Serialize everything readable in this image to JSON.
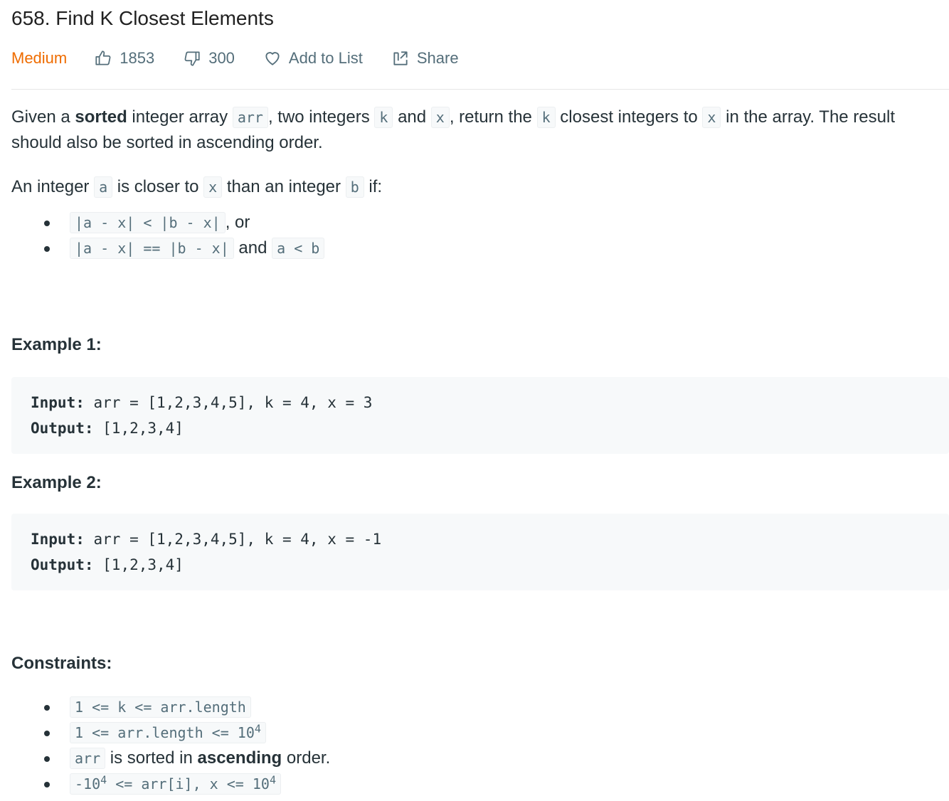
{
  "problem": {
    "title": "658. Find K Closest Elements",
    "difficulty": "Medium",
    "likes": "1853",
    "dislikes": "300",
    "add_to_list": "Add to List",
    "share": "Share"
  },
  "icons": {
    "likes": "thumbs-up-icon",
    "dislikes": "thumbs-down-icon",
    "add_to_list": "heart-icon",
    "share": "share-icon"
  },
  "colors": {
    "difficulty": "#ef6c00",
    "text": "#263238",
    "muted": "#546e7a",
    "code_bg": "#f7f9fa"
  },
  "description": {
    "p1_a": "Given a ",
    "p1_bold": "sorted",
    "p1_b": " integer array ",
    "p1_code1": "arr",
    "p1_c": ", two integers ",
    "p1_code2": "k",
    "p1_d": " and ",
    "p1_code3": "x",
    "p1_e": ", return the ",
    "p1_code4": "k",
    "p1_f": " closest integers to ",
    "p1_code5": "x",
    "p1_g": " in the array. The result should also be sorted in ascending order.",
    "p2_a": "An integer ",
    "p2_code1": "a",
    "p2_b": " is closer to ",
    "p2_code2": "x",
    "p2_c": " than an integer ",
    "p2_code3": "b",
    "p2_d": " if:",
    "bullet1_code": "|a - x| < |b - x|",
    "bullet1_text": ", or",
    "bullet2_code1": "|a - x| == |b - x|",
    "bullet2_text": " and ",
    "bullet2_code2": "a < b"
  },
  "examples": [
    {
      "heading": "Example 1:",
      "input_label": "Input:",
      "input_value": " arr = [1,2,3,4,5], k = 4, x = 3",
      "output_label": "Output:",
      "output_value": " [1,2,3,4]"
    },
    {
      "heading": "Example 2:",
      "input_label": "Input:",
      "input_value": " arr = [1,2,3,4,5], k = 4, x = -1",
      "output_label": "Output:",
      "output_value": " [1,2,3,4]"
    }
  ],
  "constraints": {
    "heading": "Constraints:",
    "c1_code": "1 <= k <= arr.length",
    "c2_code": "1 <= arr.length <= 10",
    "c2_sup": "4",
    "c3_code": "arr",
    "c3_a": " is sorted in ",
    "c3_bold": "ascending",
    "c3_b": " order.",
    "c4_code_a": "-10",
    "c4_sup_a": "4",
    "c4_code_b": " <= arr[i], x <= 10",
    "c4_sup_b": "4"
  }
}
